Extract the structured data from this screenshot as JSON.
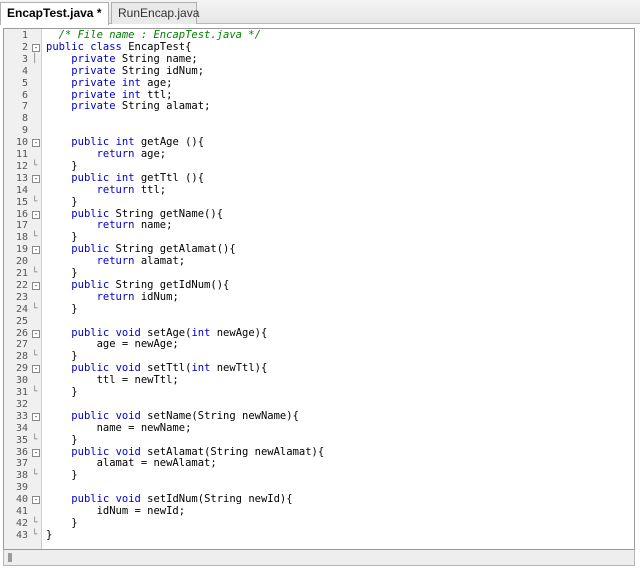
{
  "tabs": [
    {
      "label": "EncapTest.java *",
      "active": true
    },
    {
      "label": "RunEncap.java",
      "active": false
    }
  ],
  "fold_markers": {
    "2": "box",
    "3": "line",
    "10": "box",
    "12": "end",
    "13": "box",
    "15": "end",
    "16": "box",
    "18": "end",
    "19": "box",
    "21": "end",
    "22": "box",
    "24": "end",
    "26": "box",
    "28": "end",
    "29": "box",
    "31": "end",
    "33": "box",
    "35": "end",
    "36": "box",
    "38": "end",
    "40": "box",
    "42": "end",
    "43": "end"
  },
  "lines": [
    "  /* File name : EncapTest.java */",
    "public class EncapTest{",
    "    private String name;",
    "    private String idNum;",
    "    private int age;",
    "    private int ttl;",
    "    private String alamat;",
    "",
    "",
    "    public int getAge (){",
    "        return age;",
    "    }",
    "    public int getTtl (){",
    "        return ttl;",
    "    }",
    "    public String getName(){",
    "        return name;",
    "    }",
    "    public String getAlamat(){",
    "        return alamat;",
    "    }",
    "    public String getIdNum(){",
    "        return idNum;",
    "    }",
    "",
    "    public void setAge(int newAge){",
    "        age = newAge;",
    "    }",
    "    public void setTtl(int newTtl){",
    "        ttl = newTtl;",
    "    }",
    "",
    "    public void setName(String newName){",
    "        name = newName;",
    "    }",
    "    public void setAlamat(String newAlamat){",
    "        alamat = newAlamat;",
    "    }",
    "",
    "    public void setIdNum(String newId){",
    "        idNum = newId;",
    "    }",
    "}"
  ],
  "colors": {
    "keyword": "#0000cc",
    "comment": "#008000",
    "text": "#000000"
  }
}
